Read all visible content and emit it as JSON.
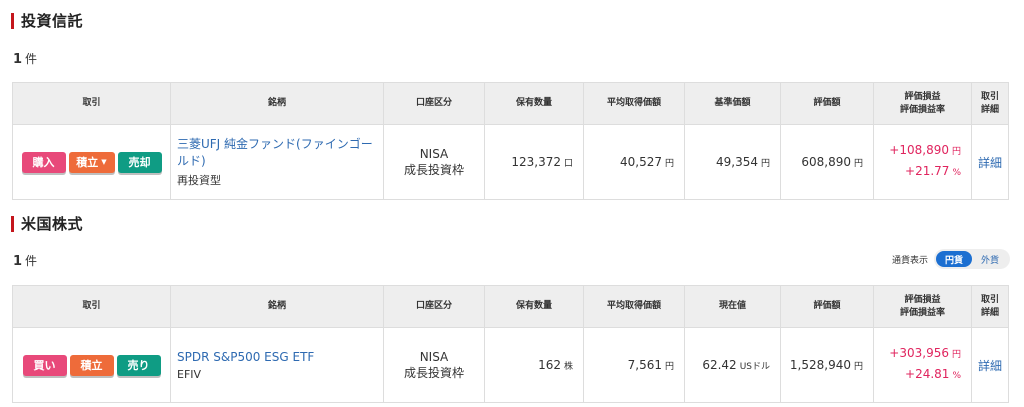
{
  "sections": [
    {
      "title": "投資信託",
      "count_num": "1",
      "count_unit": "件",
      "headers": [
        "取引",
        "銘柄",
        "口座区分",
        "保有数量",
        "平均取得価額",
        "基準価額",
        "評価額",
        "評価損益\n評価損益率",
        "取引\n詳細"
      ],
      "row": {
        "buttons": [
          "購入",
          "積立",
          "売却"
        ],
        "name": "三菱UFJ 純金ファンド(ファインゴールド)",
        "sub": "再投資型",
        "account_line1": "NISA",
        "account_line2": "成長投資枠",
        "quantity": "123,372",
        "quantity_unit": "口",
        "avg_cost": "40,527",
        "avg_cost_unit": "円",
        "price": "49,354",
        "price_unit": "円",
        "valuation": "608,890",
        "valuation_unit": "円",
        "gain": "+108,890",
        "gain_unit": "円",
        "gain_rate": "+21.77",
        "gain_rate_unit": "%",
        "detail": "詳細"
      }
    },
    {
      "title": "米国株式",
      "count_num": "1",
      "count_unit": "件",
      "headers": [
        "取引",
        "銘柄",
        "口座区分",
        "保有数量",
        "平均取得価額",
        "現在値",
        "評価額",
        "評価損益\n評価損益率",
        "取引\n詳細"
      ],
      "row": {
        "buttons": [
          "買い",
          "積立",
          "売り"
        ],
        "name": "SPDR S&P500 ESG ETF",
        "sub": "EFIV",
        "account_line1": "NISA",
        "account_line2": "成長投資枠",
        "quantity": "162",
        "quantity_unit": "株",
        "avg_cost": "7,561",
        "avg_cost_unit": "円",
        "price": "62.42",
        "price_unit": "USドル",
        "valuation": "1,528,940",
        "valuation_unit": "円",
        "gain": "+303,956",
        "gain_unit": "円",
        "gain_rate": "+24.81",
        "gain_rate_unit": "%",
        "detail": "詳細"
      }
    }
  ],
  "currency_toggle": {
    "label": "通貨表示",
    "options": [
      "円貨",
      "外貨"
    ],
    "selected": "円貨"
  },
  "colors": {
    "accent_bar": "#c4161c",
    "buy": "#e8497a",
    "tsumitate": "#ee6b3a",
    "sell": "#0f9c84",
    "link": "#2e6ab1",
    "gain": "#e0245e",
    "toggle_active": "#1c6fd1"
  },
  "icons": {
    "dropdown": "caret-down-icon"
  }
}
